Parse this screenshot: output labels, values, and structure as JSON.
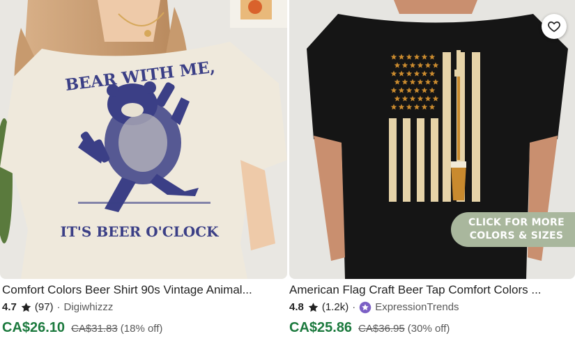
{
  "listings": [
    {
      "title": "Comfort Colors Beer Shirt 90s Vintage Animal...",
      "rating": "4.7",
      "reviews": "(97)",
      "seller": "Digiwhizzz",
      "price": "CA$26.10",
      "original_price": "CA$31.83",
      "discount": "(18% off)",
      "shirt_text_top": "BEAR WITH ME,",
      "shirt_text_bottom": "IT'S BEER O'CLOCK",
      "print_color": "#3b3f86",
      "shirt_color": "#efe9dc"
    },
    {
      "title": "American Flag Craft Beer Tap Comfort Colors ...",
      "rating": "4.8",
      "reviews": "(1.2k)",
      "seller": "ExpressionTrends",
      "seller_badge_icon": "star-seller-icon",
      "price": "CA$25.86",
      "original_price": "CA$36.95",
      "discount": "(30% off)",
      "promo_line_1": "CLICK FOR MORE",
      "promo_line_2": "COLORS & SIZES",
      "favorite_icon": "heart-outline-icon",
      "shirt_color": "#151515",
      "flag_color": "#e6d3a8",
      "star_color": "#c98a2e"
    }
  ],
  "colors": {
    "price_green": "#1c7a3e",
    "promo_badge": "#a9b79d",
    "seller_badge": "#7b5fc5"
  }
}
